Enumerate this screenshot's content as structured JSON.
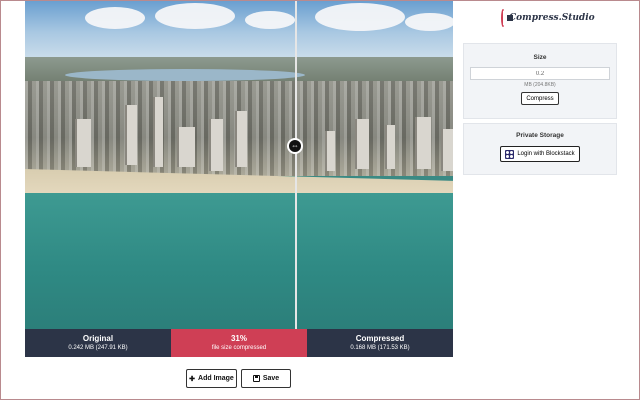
{
  "app": {
    "logo_text": "Compress.Studio",
    "logo_icon": "compress-logo-icon"
  },
  "compare": {
    "handle_icon": "compare-handle-icon",
    "handle_glyph": "⇔"
  },
  "stats": {
    "original": {
      "title": "Original",
      "detail": "0.242 MB (247.91 KB)"
    },
    "percent": {
      "title": "31%",
      "detail": "file size compressed"
    },
    "compressed": {
      "title": "Compressed",
      "detail": "0.168 MB (171.53 KB)"
    }
  },
  "actions": {
    "add_image": {
      "label": "Add Image",
      "icon": "plus-icon",
      "glyph": "✚"
    },
    "save": {
      "label": "Save",
      "icon": "save-icon",
      "glyph": "💾"
    }
  },
  "size_panel": {
    "heading": "Size",
    "value": "0.2",
    "unit_text": "MB (204.8KB)",
    "compress_label": "Compress"
  },
  "storage_panel": {
    "heading": "Private Storage",
    "login_label": "Login with Blockstack",
    "login_icon": "blockstack-icon"
  },
  "colors": {
    "dark": "#2c3447",
    "accent": "#cf3f55"
  }
}
